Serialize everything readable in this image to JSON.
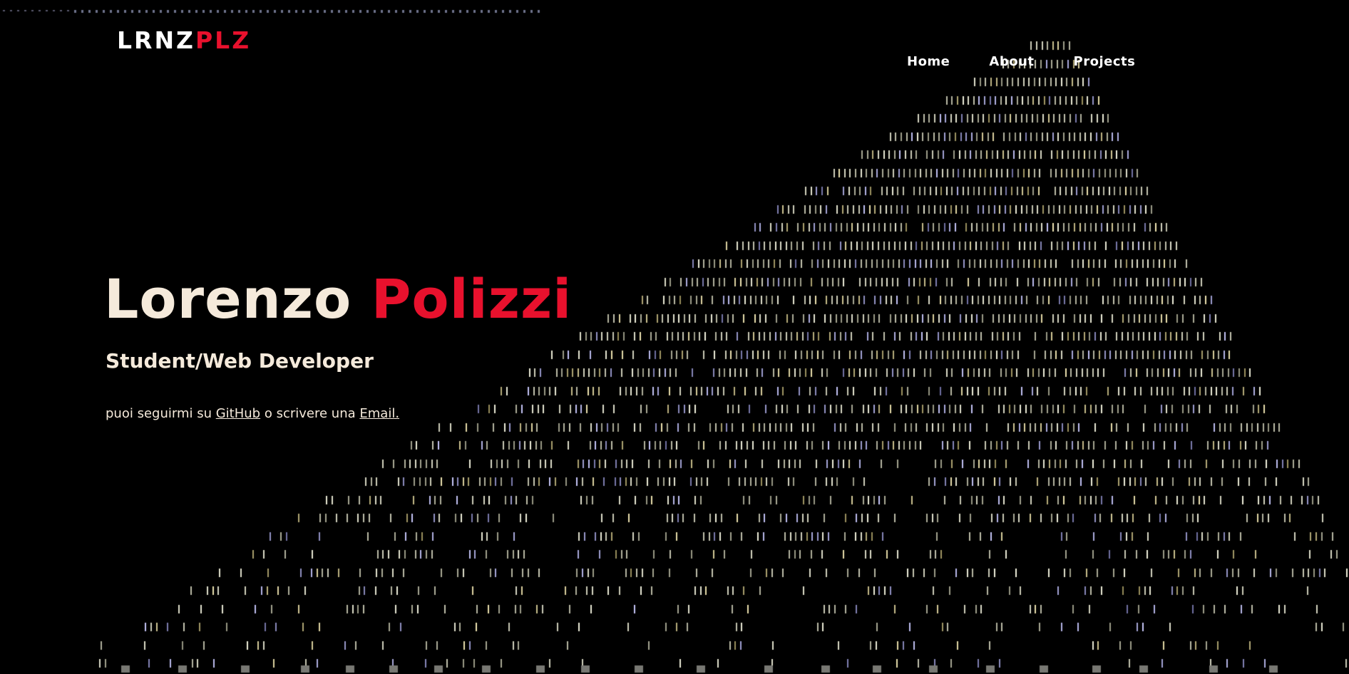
{
  "logo": {
    "part1": "LRNZ",
    "part2": "PLZ"
  },
  "nav": {
    "home": "Home",
    "about": "About",
    "projects": "Projects"
  },
  "hero": {
    "first_name": "Lorenzo",
    "last_name": "Polizzi",
    "subtitle": "Student/Web Developer",
    "follow_prefix": "puoi seguirmi su",
    "github_link": "GitHub",
    "follow_middle": "o scrivere una",
    "email_link": "Email."
  },
  "colors": {
    "background": "#000000",
    "accent": "#e8112d",
    "text": "#f5eadb",
    "nav": "#ffffff"
  }
}
